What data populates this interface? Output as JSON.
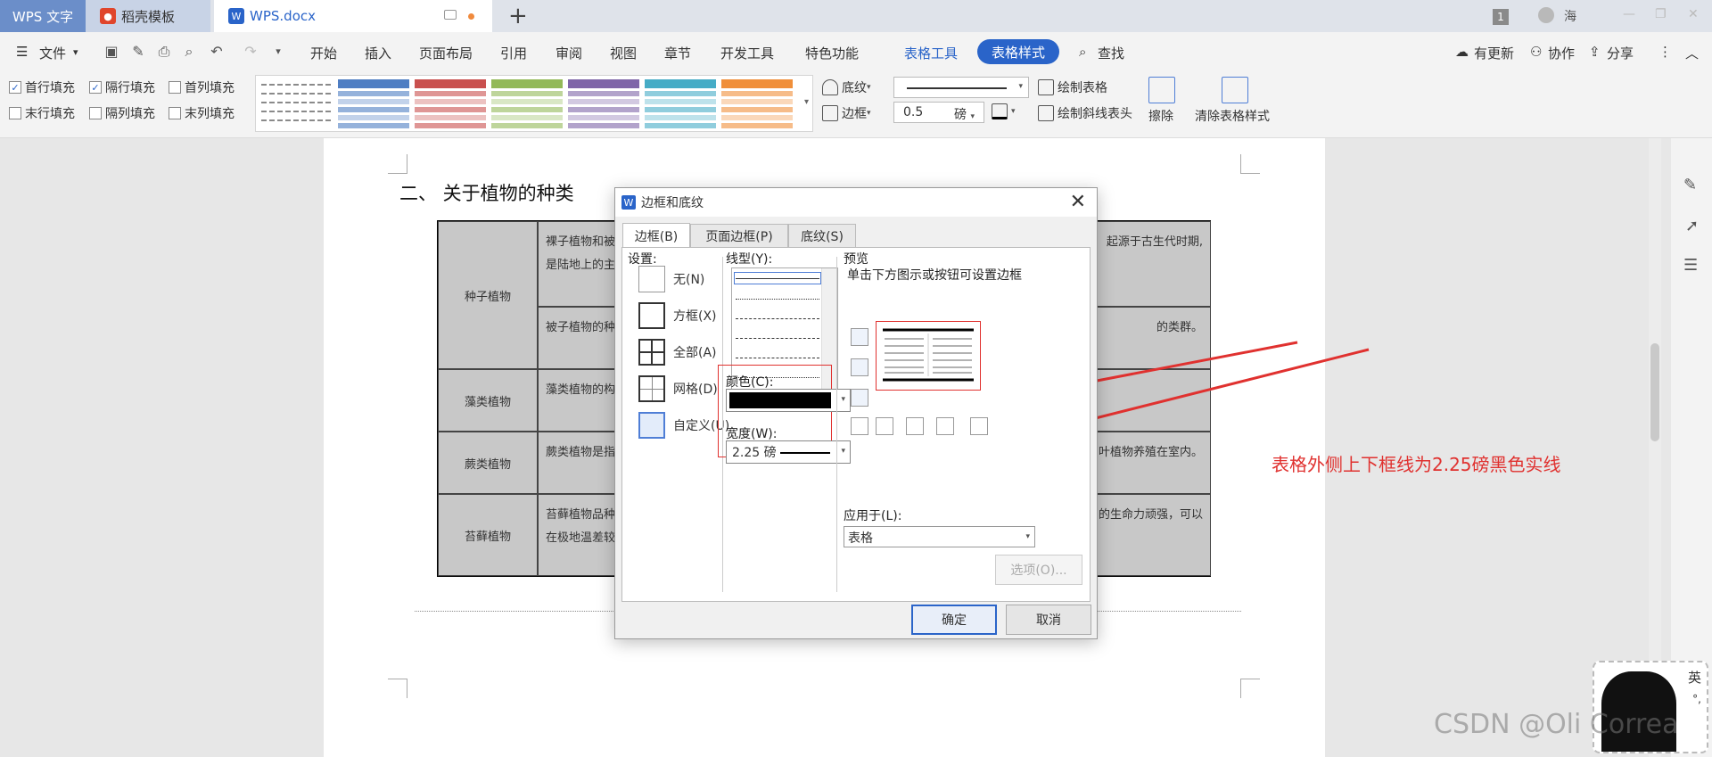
{
  "tabs": {
    "app": "WPS 文字",
    "template": "稻壳模板",
    "doc": "WPS.docx",
    "new_tab": "+"
  },
  "titlebar_right": {
    "badge": "1",
    "user": "海"
  },
  "menu": {
    "file": "文件",
    "items": [
      "开始",
      "插入",
      "页面布局",
      "引用",
      "审阅",
      "视图",
      "章节",
      "开发工具",
      "特色功能"
    ],
    "table_tools": "表格工具",
    "table_style": "表格样式",
    "search": "查找",
    "update": "有更新",
    "collab": "协作",
    "share": "分享"
  },
  "ribbon": {
    "checkboxes": [
      {
        "label": "首行填充",
        "checked": true
      },
      {
        "label": "隔行填充",
        "checked": true
      },
      {
        "label": "首列填充",
        "checked": false
      },
      {
        "label": "末行填充",
        "checked": false
      },
      {
        "label": "隔列填充",
        "checked": false
      },
      {
        "label": "末列填充",
        "checked": false
      }
    ],
    "shading": "底纹",
    "border": "边框",
    "line_width": "0.5",
    "line_unit": "磅",
    "draw_table": "绘制表格",
    "draw_diag": "绘制斜线表头",
    "erase": "擦除",
    "clear_style": "清除表格样式",
    "style_colors": [
      "#4f7ec3",
      "#c9504e",
      "#93b958",
      "#7f65a8",
      "#46acc6",
      "#f08f3a"
    ]
  },
  "document": {
    "heading": "二、 关于植物的种类",
    "rows": [
      {
        "category": "种子植物",
        "cells": [
          {
            "left": "裸子植物和被",
            "left2": "是陆地上的主",
            "right": "起源于古生代时期,"
          },
          {
            "left": "被子植物的种",
            "right": "的类群。"
          }
        ]
      },
      {
        "category": "藻类植物",
        "cells": [
          {
            "left": "藻类植物的构",
            "right": ""
          }
        ]
      },
      {
        "category": "蕨类植物",
        "cells": [
          {
            "left": "蕨类植物是指",
            "right": "叶植物养殖在室内。"
          }
        ]
      },
      {
        "category": "苔藓植物",
        "cells": [
          {
            "left": "苔藓植物品种",
            "left2": "在极地温差较",
            "right": "的生命力顽强，可以"
          }
        ]
      }
    ]
  },
  "annotation": "表格外侧上下框线为2.25磅黑色实线",
  "dialog": {
    "title": "边框和底纹",
    "tabs": [
      "边框(B)",
      "页面边框(P)",
      "底纹(S)"
    ],
    "settings_label": "设置:",
    "settings": [
      "无(N)",
      "方框(X)",
      "全部(A)",
      "网格(D)",
      "自定义(U)"
    ],
    "line_style_label": "线型(Y):",
    "color_label": "颜色(C):",
    "color_value": "#000000",
    "width_label": "宽度(W):",
    "width_value": "2.25 磅",
    "preview_label": "预览",
    "preview_hint": "单击下方图示或按钮可设置边框",
    "apply_label": "应用于(L):",
    "apply_value": "表格",
    "options_button": "选项(O)...",
    "ok": "确定",
    "cancel": "取消"
  },
  "watermark": "CSDN @Oli Correa",
  "ime": {
    "lang": "英",
    "punct": "°,"
  }
}
